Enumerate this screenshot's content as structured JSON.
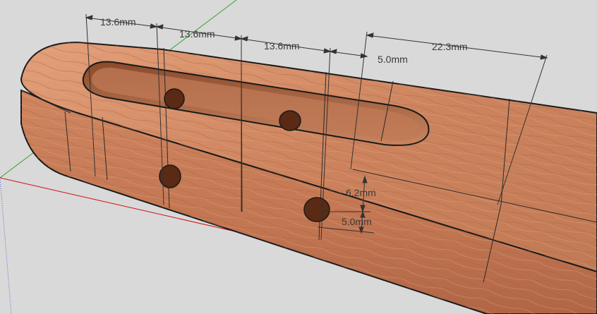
{
  "colors": {
    "background": "#d9d9d9",
    "wood_light": "#d9906a",
    "wood_mid": "#c07450",
    "wood_dark": "#8f4f32",
    "hole": "#5a2a14",
    "edge": "#1a1a1a",
    "dimension_line": "#333333",
    "axis_red": "#d01010",
    "axis_green": "#2aa82a",
    "axis_blue": "#5a5ad0"
  },
  "dimensions": {
    "d1": "13.6mm",
    "d2": "13.6mm",
    "d3": "13.6mm",
    "d4": "5.0mm",
    "d5": "22.3mm",
    "d6": "6.2mm",
    "d7": "5.0mm"
  }
}
